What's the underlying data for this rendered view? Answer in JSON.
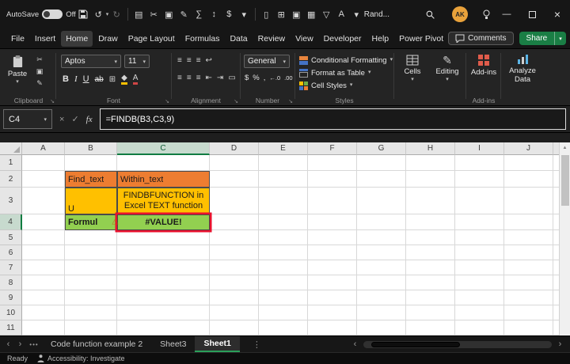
{
  "colors": {
    "accent_green": "#107C41",
    "share_green": "#1A7E45",
    "tab_underline": "#2BA05A",
    "avatar_bg": "#E9A23B",
    "error_red": "#E8112D",
    "orange": "#ED7D31",
    "yellow": "#FFC000",
    "green": "#92D050"
  },
  "icons": {
    "dropdown": "▾",
    "undo": "↺",
    "redo": "↻",
    "minimize": "—",
    "close": "×",
    "bold": "B",
    "italic": "I",
    "underline": "U",
    "strike": "ab",
    "borders": "⊞",
    "fill": "◆",
    "font_color": "A",
    "align_top": "≡",
    "align_mid": "≡",
    "align_bottom": "≡",
    "wrap": "↩",
    "align_left": "≡",
    "align_center": "≡",
    "align_right": "≡",
    "indent_out": "⇤",
    "indent_in": "⇥",
    "merge": "▭",
    "dollar": "$",
    "percent": "%",
    "comma": ",",
    "dec_inc": "←.0",
    "dec_dec": ".00",
    "cancel": "×",
    "check": "✓",
    "fx": "fx",
    "warning": "⚠",
    "launcher": "↘",
    "prev": "‹",
    "next": "›",
    "more_dots": "•••",
    "vdots": "⋮",
    "pencil": "✎"
  },
  "titlebar": {
    "autosave_label": "AutoSave",
    "autosave_state": "Off",
    "document_name": "Rand...",
    "avatar_initials": "AK",
    "qat1": [
      [
        "paste",
        "▤"
      ],
      [
        "cut",
        "✂"
      ],
      [
        "copy",
        "▣"
      ],
      [
        "format-painter",
        "✎"
      ],
      [
        "autosum",
        "∑"
      ],
      [
        "sort",
        "↕"
      ],
      [
        "currency",
        "$"
      ],
      [
        "more",
        "▾"
      ]
    ],
    "qat2": [
      [
        "new-file",
        "▯"
      ],
      [
        "grid",
        "⊞"
      ],
      [
        "picture",
        "▣"
      ],
      [
        "table",
        "▦"
      ],
      [
        "filter",
        "▽"
      ],
      [
        "font",
        "A"
      ],
      [
        "more",
        "▾"
      ]
    ]
  },
  "menubar": {
    "items": [
      "File",
      "Insert",
      "Home",
      "Draw",
      "Page Layout",
      "Formulas",
      "Data",
      "Review",
      "View",
      "Developer",
      "Help",
      "Power Pivot"
    ],
    "active": "Home",
    "comments_label": "Comments",
    "share_label": "Share"
  },
  "ribbon": {
    "paste_label": "Paste",
    "clipboard_group": "Clipboard",
    "font_name": "Aptos",
    "font_size": "11",
    "font_group": "Font",
    "alignment_group": "Alignment",
    "number_format": "General",
    "number_group": "Number",
    "conditional_formatting": "Conditional Formatting",
    "format_as_table": "Format as Table",
    "cell_styles": "Cell Styles",
    "styles_group": "Styles",
    "cells_label": "Cells",
    "editing_label": "Editing",
    "addins_label": "Add-ins",
    "addins_group": "Add-ins",
    "analyze_label": "Analyze Data"
  },
  "formula_bar": {
    "name_box": "C4",
    "formula": "=FINDB(B3,C3,9)"
  },
  "grid": {
    "columns": [
      "A",
      "B",
      "C",
      "D",
      "E",
      "F",
      "G",
      "H",
      "I",
      "J"
    ],
    "rows": [
      "1",
      "2",
      "3",
      "4",
      "5",
      "6",
      "7",
      "8",
      "9",
      "10",
      "11"
    ],
    "selected": {
      "col": "C",
      "row": "4"
    },
    "cells": [
      {
        "ref": "B2",
        "text": "Find_text",
        "bg": "orange",
        "align": "left"
      },
      {
        "ref": "C2",
        "text": "Within_text",
        "bg": "orange",
        "align": "left"
      },
      {
        "ref": "B3",
        "text": "U",
        "bg": "yellow",
        "align": "left",
        "valign": "bottom"
      },
      {
        "ref": "C3",
        "text": "FINDBFUNCTION in Excel TEXT function",
        "bg": "yellow",
        "align": "center",
        "wrap": true
      },
      {
        "ref": "B4",
        "text": "Formul",
        "bg": "green",
        "align": "left",
        "bold": true,
        "warning": true
      },
      {
        "ref": "C4",
        "text": "#VALUE!",
        "bg": "green",
        "align": "center",
        "bold": true,
        "error_box": true
      }
    ]
  },
  "sheet_tabs": {
    "tabs": [
      "Code function example 2",
      "Sheet3",
      "Sheet1"
    ],
    "active": "Sheet1"
  },
  "status_bar": {
    "ready": "Ready",
    "accessibility": "Accessibility: Investigate"
  }
}
